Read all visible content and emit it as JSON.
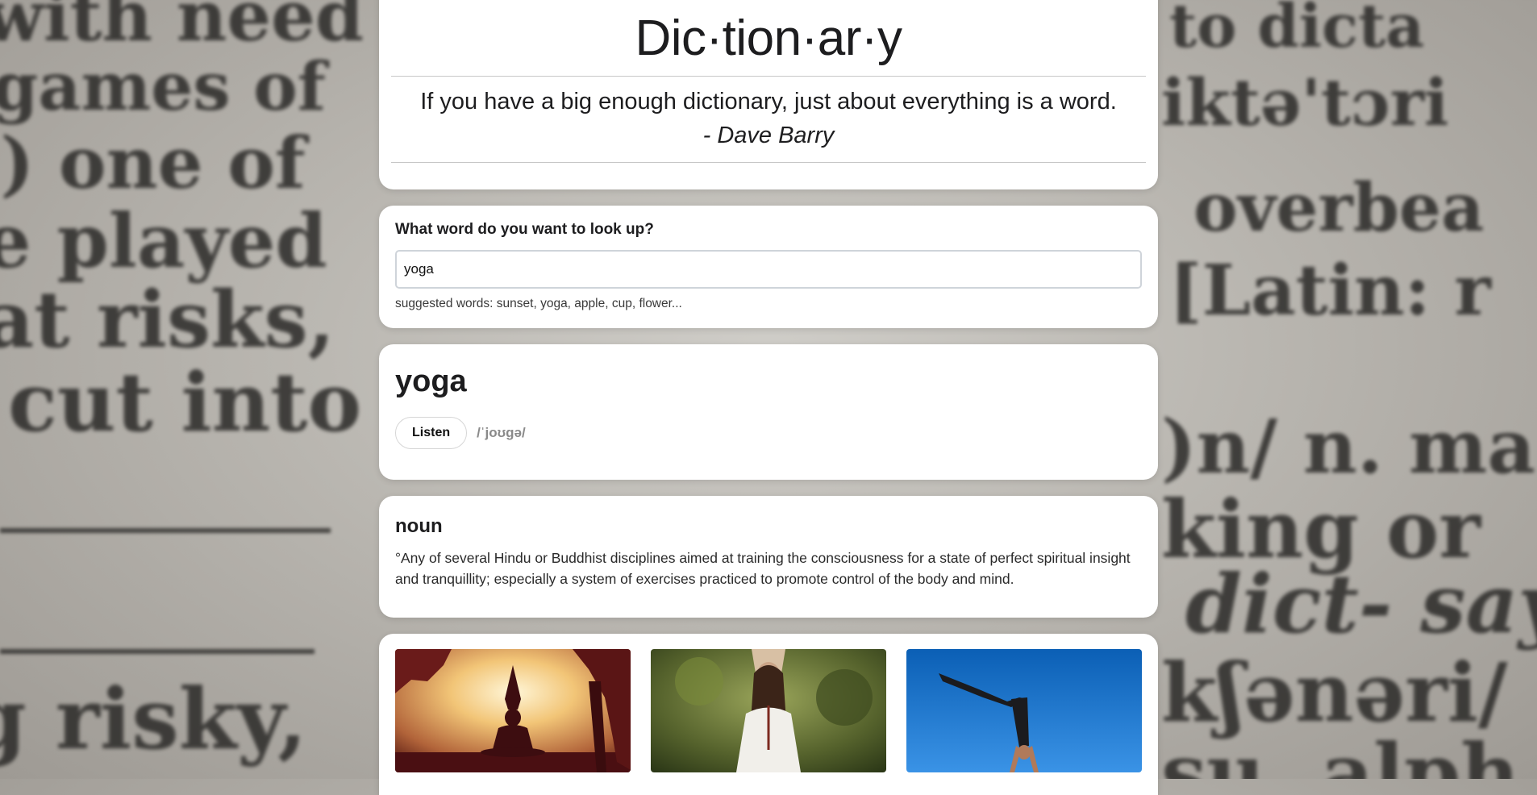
{
  "header": {
    "title": "Dic·tion·ar·y",
    "quote": "If you have a big enough dictionary, just about everything is a word.",
    "author": "- Dave Barry"
  },
  "search": {
    "label": "What word do you want to look up?",
    "value": "yoga",
    "hint": "suggested words: sunset, yoga, apple, cup, flower..."
  },
  "result": {
    "word": "yoga",
    "listen_label": "Listen",
    "phonetic": "/ˈjoʊɡə/"
  },
  "meanings": [
    {
      "part_of_speech": "noun",
      "definition": "°Any of several Hindu or Buddhist disciplines aimed at training the consciousness for a state of perfect spiritual insight and tranquillity; especially a system of exercises practiced to promote control of the body and mind."
    }
  ],
  "photos": [
    {
      "subject": "meditation-silhouette-sunset"
    },
    {
      "subject": "woman-stretching-in-forest"
    },
    {
      "subject": "handstand-against-blue-sky"
    }
  ]
}
